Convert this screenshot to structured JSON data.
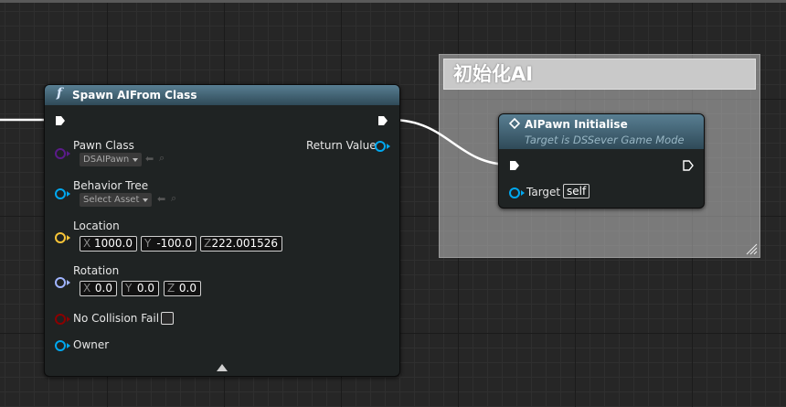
{
  "colors": {
    "exec_pin": "#ffffff",
    "class_pin": "#5b1b8a",
    "object_pin": "#00a8f0",
    "vector_pin": "#f7c437",
    "rotator_pin": "#a0b4ff",
    "bool_pin": "#8b0000",
    "node_header": "#587e92"
  },
  "comment": {
    "title": "初始化AI"
  },
  "spawn_node": {
    "icon": "f",
    "title": "Spawn AIFrom Class",
    "pins": {
      "pawn_class": {
        "label": "Pawn Class",
        "value": "DSAIPawn"
      },
      "behavior_tree": {
        "label": "Behavior Tree",
        "value": "Select Asset"
      },
      "location": {
        "label": "Location",
        "x_axis": "X",
        "x": "1000.0",
        "y_axis": "Y",
        "y": "-100.0",
        "z_axis": "Z",
        "z": "222.001526"
      },
      "rotation": {
        "label": "Rotation",
        "x_axis": "X",
        "x": "0.0",
        "y_axis": "Y",
        "y": "0.0",
        "z_axis": "Z",
        "z": "0.0"
      },
      "no_collision_fail": {
        "label": "No Collision Fail",
        "checked": false
      },
      "owner": {
        "label": "Owner"
      },
      "return_value": {
        "label": "Return Value"
      }
    }
  },
  "init_node": {
    "title": "AIPawn Initialise",
    "subtitle": "Target is DSSever Game Mode",
    "pins": {
      "target": {
        "label": "Target",
        "value": "self"
      }
    }
  }
}
